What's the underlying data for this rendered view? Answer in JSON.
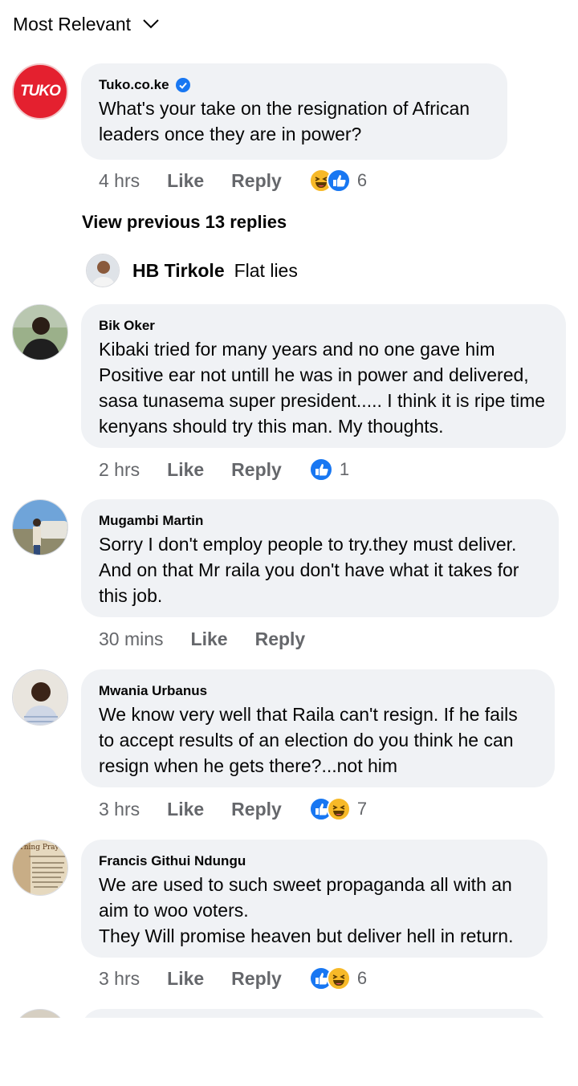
{
  "sort": {
    "label": "Most Relevant",
    "icon": "chevron-down-icon"
  },
  "post": {
    "author": "Tuko.co.ke",
    "logo_text": "TUKO",
    "text": "What's your take on the resignation of African leaders once they are in power?",
    "time": "4 hrs",
    "like": "Like",
    "reply": "Reply",
    "reaction_count": "6",
    "reactions": [
      "haha",
      "like"
    ]
  },
  "view_previous": "View previous 13 replies",
  "reply_preview": {
    "author": "HB Tirkole",
    "text": "Flat lies"
  },
  "comments": [
    {
      "author": "Bik Oker",
      "text": "Kibaki tried for many years and no one gave him Positive ear not untill he was in power and delivered, sasa tunasema super president..... I think it is ripe time kenyans should try this man. My thoughts.",
      "time": "2 hrs",
      "like": "Like",
      "reply": "Reply",
      "reaction_count": "1"
    },
    {
      "author": "Mugambi Martin",
      "text": "Sorry I don't employ people to try.they must deliver. And on that Mr raila you don't have what it takes for this job.",
      "time": "30 mins",
      "like": "Like",
      "reply": "Reply"
    },
    {
      "author": "Mwania Urbanus",
      "text": "We know very well that Raila can't resign. If he fails to accept results of an election do you think he can resign when he gets there?...not him",
      "time": "3 hrs",
      "like": "Like",
      "reply": "Reply",
      "reaction_count": "7"
    },
    {
      "author": "Francis Githui Ndungu",
      "text": "We are used to such sweet propaganda all with an aim to woo voters.\nThey Will promise heaven but deliver hell in return.",
      "time": "3 hrs",
      "like": "Like",
      "reply": "Reply",
      "reaction_count": "6",
      "avatar_text": "orning Pray"
    }
  ],
  "colors": {
    "like_blue": "#1877f2",
    "haha_yellow": "#f7b928",
    "tuko_red": "#e4202f",
    "bubble": "#f0f2f5",
    "meta_gray": "#65676b"
  }
}
